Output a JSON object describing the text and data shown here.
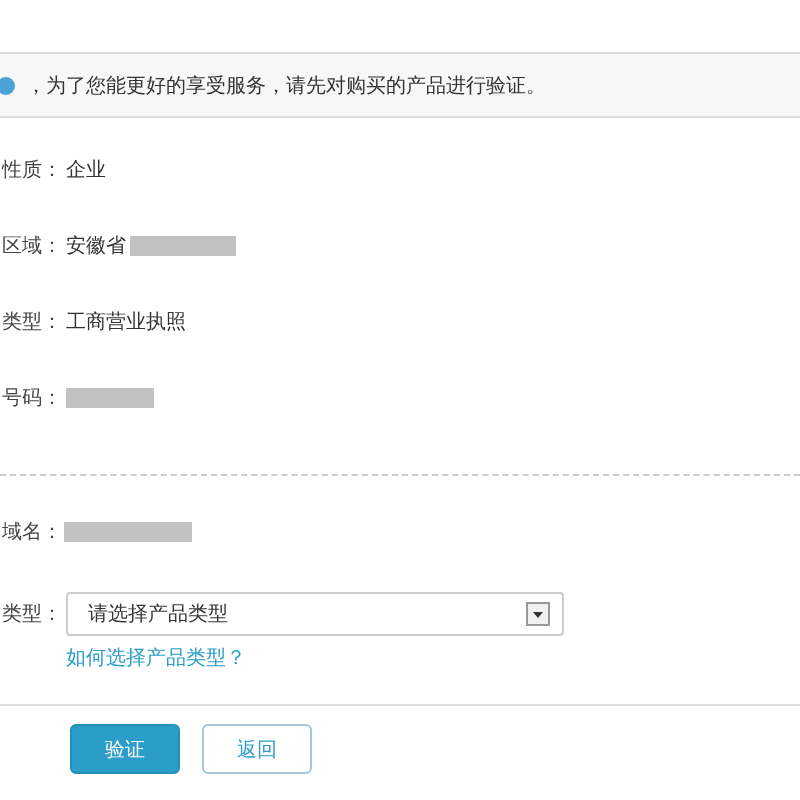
{
  "notice": {
    "text": "，为了您能更好的享受服务，请先对购买的产品进行验证。"
  },
  "info_rows": [
    {
      "label": "性质：",
      "value": "企业",
      "redacted": false
    },
    {
      "label": "区域：",
      "value": "安徽省",
      "redacted": true
    },
    {
      "label": "类型：",
      "value": "工商营业执照",
      "redacted": false
    },
    {
      "label": "号码：",
      "redacted": true
    }
  ],
  "domain_row": {
    "label": "域名：",
    "redacted": true
  },
  "product_type": {
    "label": "类型：",
    "placeholder": "请选择产品类型",
    "help_link": "如何选择产品类型？"
  },
  "buttons": [
    {
      "label": "验证",
      "kind": "primary"
    },
    {
      "label": "返回",
      "kind": "secondary"
    }
  ]
}
